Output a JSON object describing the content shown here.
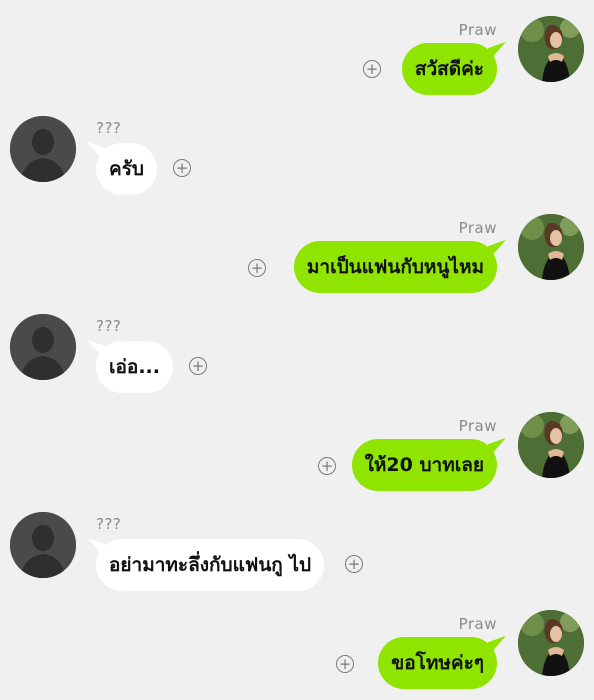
{
  "messages": [
    {
      "side": "me",
      "name": "Praw",
      "text": "สวัสดีค่ะ"
    },
    {
      "side": "them",
      "name": "???",
      "text": "ครับ"
    },
    {
      "side": "me",
      "name": "Praw",
      "text": "มาเป็นแฟนกับหนูไหม"
    },
    {
      "side": "them",
      "name": "???",
      "text": "เอ่อ..."
    },
    {
      "side": "me",
      "name": "Praw",
      "text": "ให้20 บาทเลย"
    },
    {
      "side": "them",
      "name": "???",
      "text": "อย่ามาทะลึ่งกับแฟนกู ไป"
    },
    {
      "side": "me",
      "name": "Praw",
      "text": "ขอโทษค่ะๆ"
    }
  ],
  "colors": {
    "background": "#f0f0f0",
    "my_bubble": "#8fe400",
    "their_bubble": "#ffffff",
    "name_text": "#8a8a8a"
  },
  "icons": {
    "add_reaction": "plus-circle-icon",
    "contact_avatar": "person-silhouette-icon",
    "my_avatar": "profile-photo"
  }
}
